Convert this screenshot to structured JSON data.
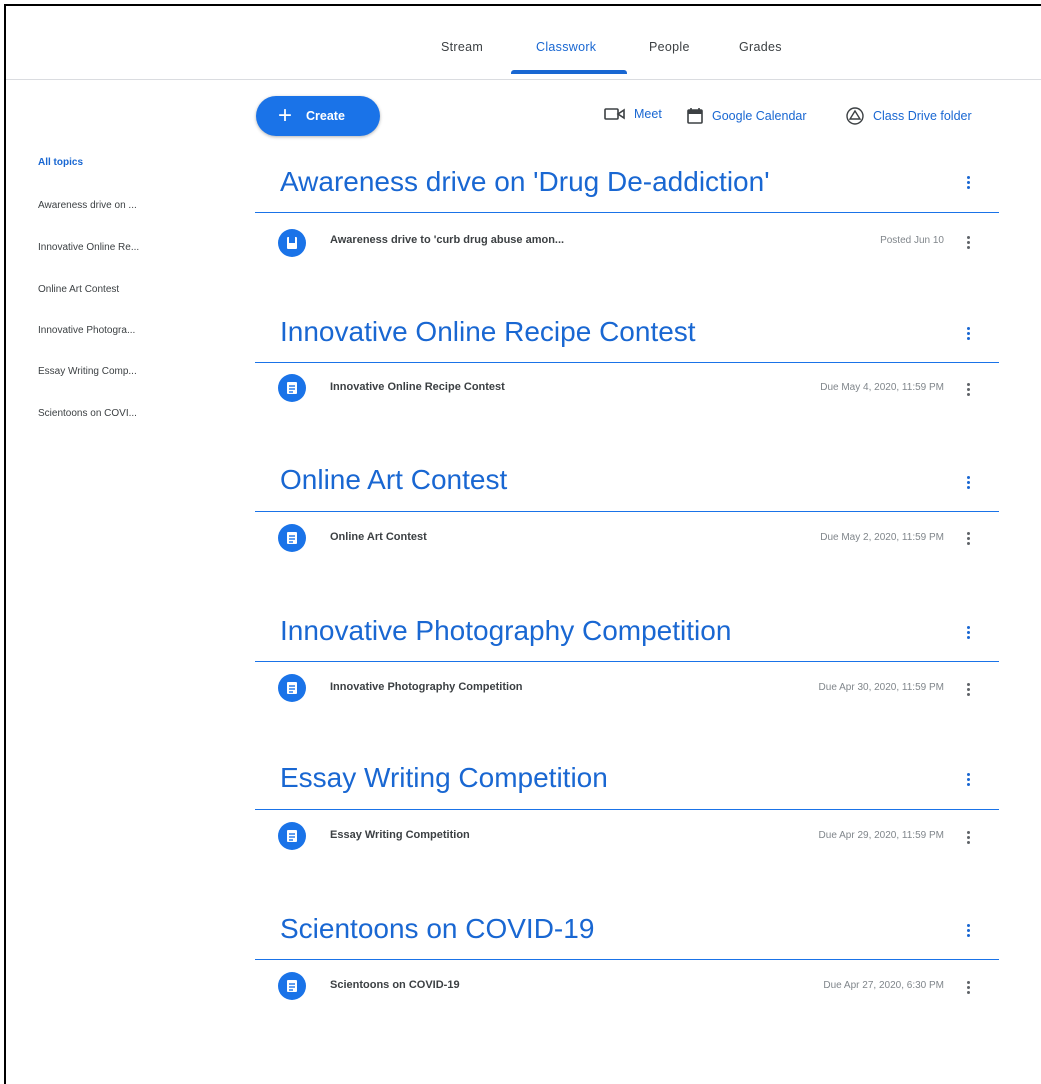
{
  "tabs": [
    {
      "label": "Stream"
    },
    {
      "label": "Classwork"
    },
    {
      "label": "People"
    },
    {
      "label": "Grades"
    }
  ],
  "active_tab": "Classwork",
  "create_label": "Create",
  "toolbar": {
    "meet": "Meet",
    "calendar": "Google Calendar",
    "drive": "Class Drive folder"
  },
  "sidebar": {
    "items": [
      {
        "label": "All topics"
      },
      {
        "label": "Awareness drive on ..."
      },
      {
        "label": "Innovative Online Re..."
      },
      {
        "label": "Online Art Contest"
      },
      {
        "label": "Innovative Photogra..."
      },
      {
        "label": "Essay Writing Comp..."
      },
      {
        "label": "Scientoons on COVI..."
      }
    ]
  },
  "topics": [
    {
      "title": "Awareness drive on 'Drug De-addiction'",
      "item": {
        "title": "Awareness drive to 'curb drug abuse amon...",
        "date": "Posted Jun 10",
        "icon": "material-icon"
      }
    },
    {
      "title": "Innovative Online Recipe Contest",
      "item": {
        "title": "Innovative Online Recipe Contest",
        "date": "Due May 4, 2020, 11:59 PM",
        "icon": "assignment-icon"
      }
    },
    {
      "title": "Online Art Contest",
      "item": {
        "title": "Online Art Contest",
        "date": "Due May 2, 2020, 11:59 PM",
        "icon": "assignment-icon"
      }
    },
    {
      "title": "Innovative Photography Competition",
      "item": {
        "title": "Innovative Photography Competition",
        "date": "Due Apr 30, 2020, 11:59 PM",
        "icon": "assignment-icon"
      }
    },
    {
      "title": "Essay Writing Competition",
      "item": {
        "title": "Essay Writing Competition",
        "date": "Due Apr 29, 2020, 11:59 PM",
        "icon": "assignment-icon"
      }
    },
    {
      "title": "Scientoons on COVID-19",
      "item": {
        "title": "Scientoons on COVID-19",
        "date": "Due Apr 27, 2020, 6:30 PM",
        "icon": "assignment-icon"
      }
    }
  ],
  "colors": {
    "accent": "#1967d2",
    "button": "#1a73e8"
  }
}
